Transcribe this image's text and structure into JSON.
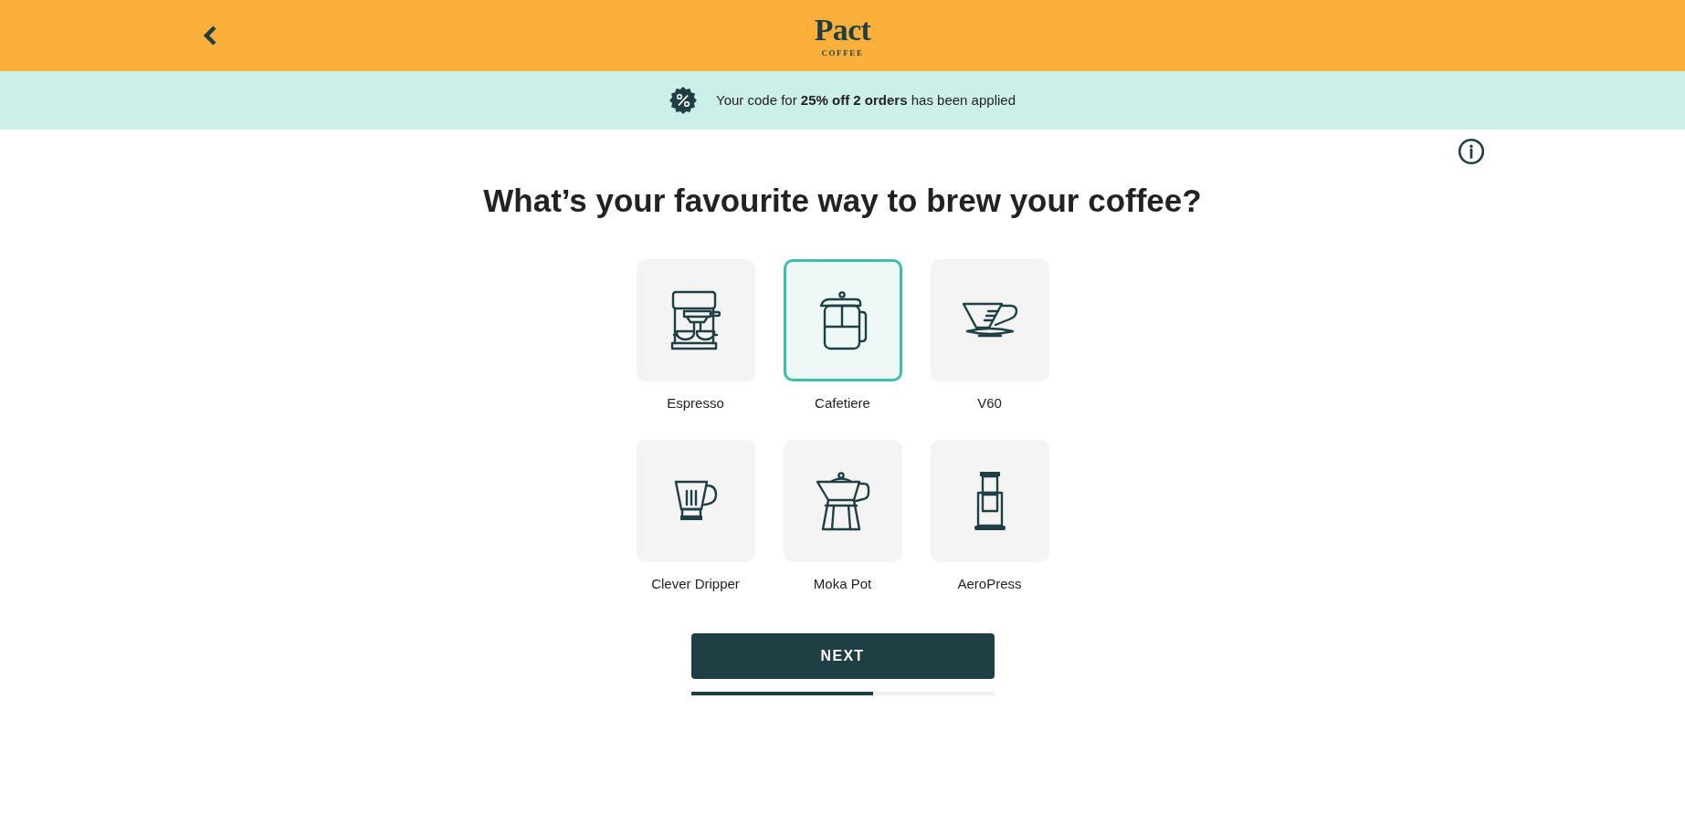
{
  "header": {
    "logo": {
      "name": "Pact",
      "tagline": "COFFEE"
    }
  },
  "banner": {
    "text": "Your code for **25% off 2 orders** has been applied"
  },
  "question": "What’s your favourite way to brew your coffee?",
  "options": [
    {
      "label": "Espresso",
      "kind": "espresso",
      "selected": false
    },
    {
      "label": "Cafetiere",
      "kind": "cafetiere",
      "selected": true
    },
    {
      "label": "V60",
      "kind": "v60",
      "selected": false
    },
    {
      "label": "Clever Dripper",
      "kind": "dripper",
      "selected": false
    },
    {
      "label": "Moka Pot",
      "kind": "moka",
      "selected": false
    },
    {
      "label": "AeroPress",
      "kind": "aeropress",
      "selected": false
    }
  ],
  "next_button": {
    "label": "NEXT"
  },
  "progress": {
    "level": 0.6
  }
}
